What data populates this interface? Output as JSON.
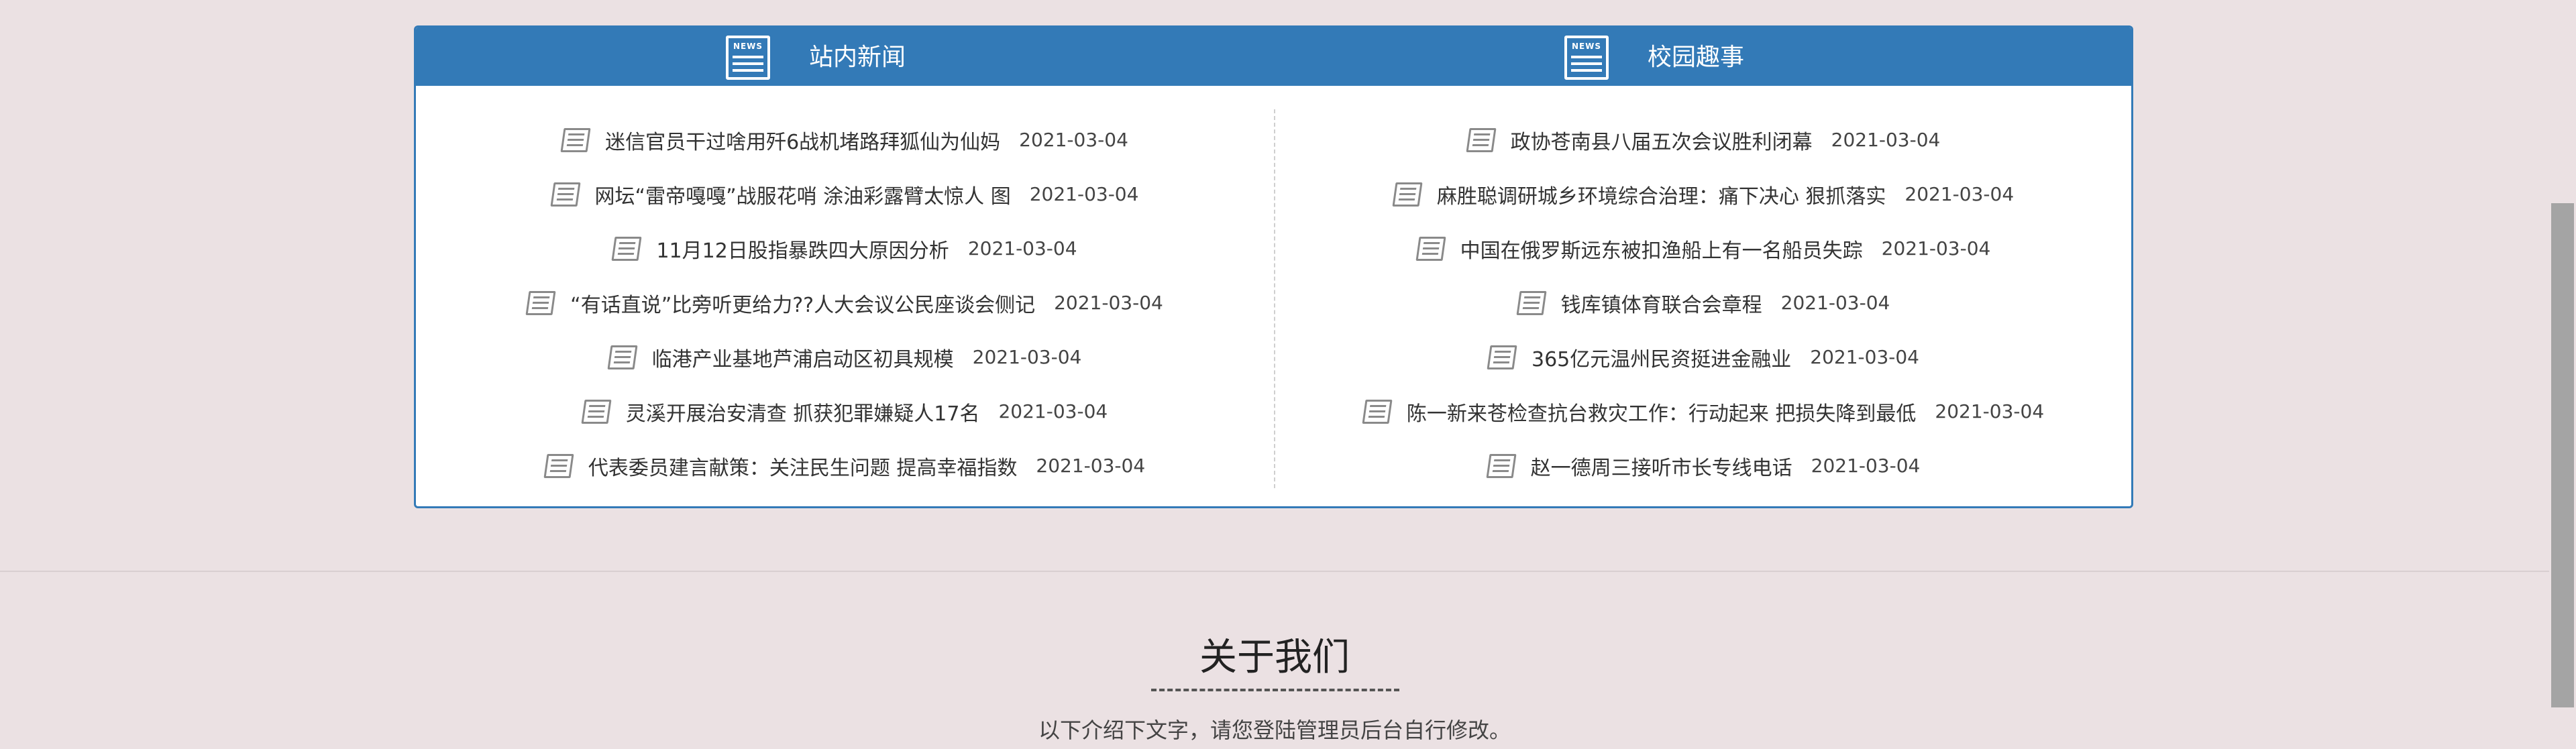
{
  "news": {
    "left": {
      "title": "站内新闻",
      "items": [
        {
          "title": "迷信官员干过啥用歼6战机堵路拜狐仙为仙妈",
          "date": "2021-03-04"
        },
        {
          "title": "网坛“雷帝嘎嘎”战服花哨 涂油彩露臂太惊人 图",
          "date": "2021-03-04"
        },
        {
          "title": "11月12日股指暴跌四大原因分析",
          "date": "2021-03-04"
        },
        {
          "title": "“有话直说”比旁听更给力??人大会议公民座谈会侧记",
          "date": "2021-03-04"
        },
        {
          "title": "临港产业基地芦浦启动区初具规模",
          "date": "2021-03-04"
        },
        {
          "title": "灵溪开展治安清查 抓获犯罪嫌疑人17名",
          "date": "2021-03-04"
        },
        {
          "title": "代表委员建言献策：关注民生问题 提高幸福指数",
          "date": "2021-03-04"
        }
      ]
    },
    "right": {
      "title": "校园趣事",
      "items": [
        {
          "title": "政协苍南县八届五次会议胜利闭幕",
          "date": "2021-03-04"
        },
        {
          "title": "麻胜聪调研城乡环境综合治理：痛下决心 狠抓落实",
          "date": "2021-03-04"
        },
        {
          "title": "中国在俄罗斯远东被扣渔船上有一名船员失踪",
          "date": "2021-03-04"
        },
        {
          "title": "钱库镇体育联合会章程",
          "date": "2021-03-04"
        },
        {
          "title": "365亿元温州民资挺进金融业",
          "date": "2021-03-04"
        },
        {
          "title": "陈一新来苍检查抗台救灾工作：行动起来 把损失降到最低",
          "date": "2021-03-04"
        },
        {
          "title": "赵一德周三接听市长专线电话",
          "date": "2021-03-04"
        }
      ]
    },
    "icon_text": "NEWS",
    "accent_color": "#337ab7"
  },
  "about": {
    "title": "关于我们",
    "description": "以下介绍下文字，请您登陆管理员后台自行修改。"
  }
}
